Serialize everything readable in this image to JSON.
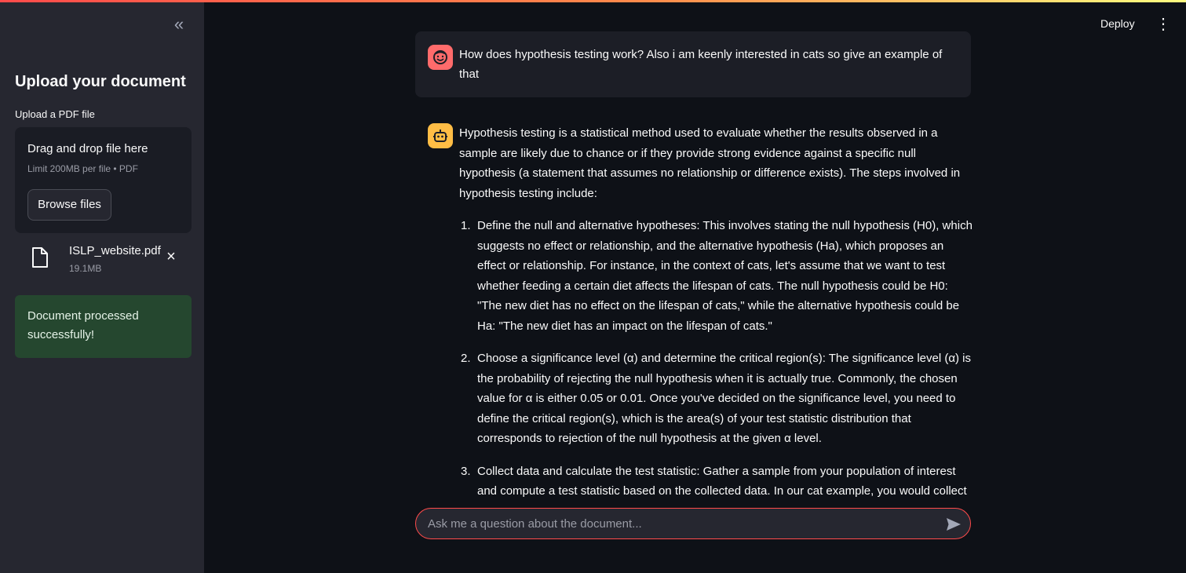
{
  "header": {
    "deploy_label": "Deploy",
    "menu_icon": "kebab-menu-icon"
  },
  "sidebar": {
    "collapse_icon": "«",
    "title": "Upload your document",
    "upload_label": "Upload a PDF file",
    "dropzone": {
      "title": "Drag and drop file here",
      "limit": "Limit 200MB per file • PDF",
      "browse_label": "Browse files"
    },
    "file": {
      "name": "ISLP_website.pdf",
      "size": "19.1MB",
      "icon": "file-icon",
      "remove_icon": "×"
    },
    "status": "Document processed successfully!"
  },
  "chat": {
    "user_message": "How does hypothesis testing work? Also i am keenly interested in cats so give an example of that",
    "bot_intro": "Hypothesis testing is a statistical method used to evaluate whether the results observed in a sample are likely due to chance or if they provide strong evidence against a specific null hypothesis (a statement that assumes no relationship or difference exists). The steps involved in hypothesis testing include:",
    "bot_items": [
      {
        "num": "1.",
        "text": "Define the null and alternative hypotheses: This involves stating the null hypothesis (H0), which suggests no effect or relationship, and the alternative hypothesis (Ha), which proposes an effect or relationship. For instance, in the context of cats, let's assume that we want to test whether feeding a certain diet affects the lifespan of cats. The null hypothesis could be H0: \"The new diet has no effect on the lifespan of cats,\" while the alternative hypothesis could be Ha: \"The new diet has an impact on the lifespan of cats.\""
      },
      {
        "num": "2.",
        "text": "Choose a significance level (α) and determine the critical region(s): The significance level (α) is the probability of rejecting the null hypothesis when it is actually true. Commonly, the chosen value for α is either 0.05 or 0.01. Once you've decided on the significance level, you need to define the critical region(s), which is the area(s) of your test statistic distribution that corresponds to rejection of the null hypothesis at the given α level."
      },
      {
        "num": "3.",
        "text": "Collect data and calculate the test statistic: Gather a sample from your population of interest and compute a test statistic based on the collected data. In our cat example, you would collect"
      }
    ],
    "input_placeholder": "Ask me a question about the document...",
    "send_icon": "send-icon"
  },
  "colors": {
    "accent": "#ff4b4b",
    "user_avatar": "#ff6b6b",
    "bot_avatar": "#ffbd45",
    "success_bg": "#25472f"
  }
}
